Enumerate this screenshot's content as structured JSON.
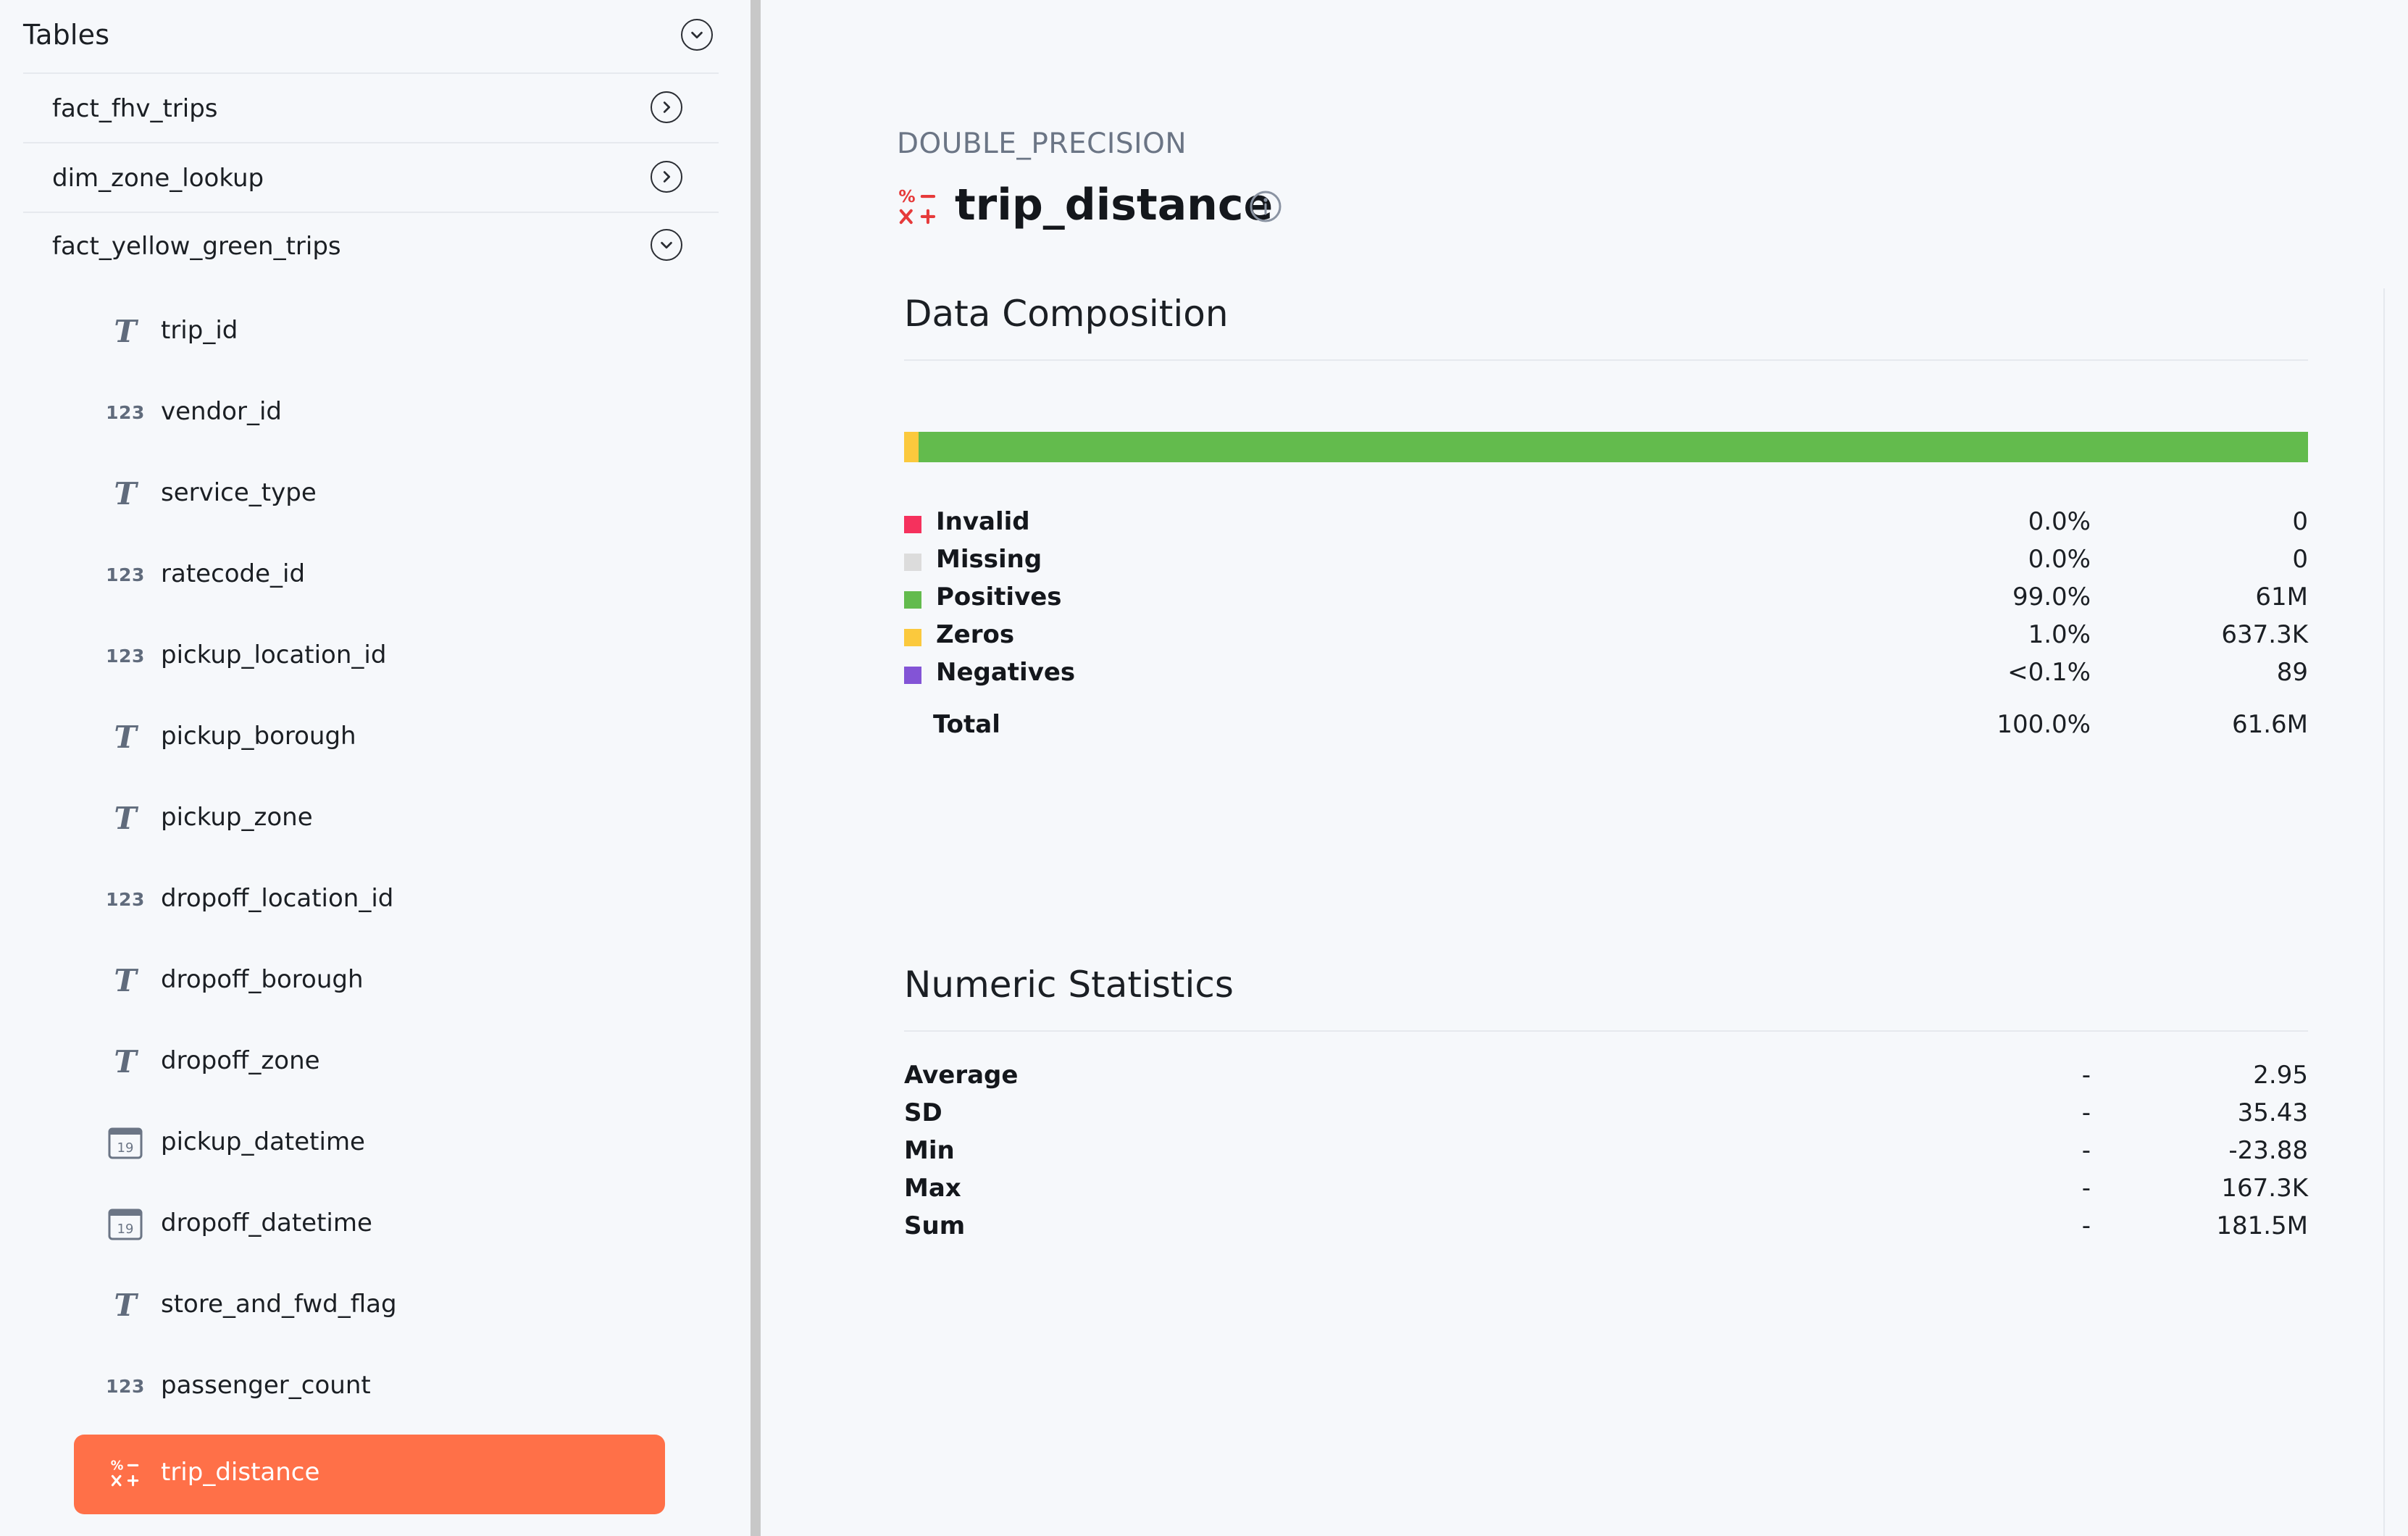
{
  "sidebar": {
    "title": "Tables",
    "tables": [
      {
        "name": "fact_fhv_trips",
        "expanded": false
      },
      {
        "name": "dim_zone_lookup",
        "expanded": false
      },
      {
        "name": "fact_yellow_green_trips",
        "expanded": true
      }
    ],
    "columns": [
      {
        "name": "trip_id",
        "type_icon": "text-type-icon",
        "glyph": "T"
      },
      {
        "name": "vendor_id",
        "type_icon": "integer-type-icon",
        "glyph": "123"
      },
      {
        "name": "service_type",
        "type_icon": "text-type-icon",
        "glyph": "T"
      },
      {
        "name": "ratecode_id",
        "type_icon": "integer-type-icon",
        "glyph": "123"
      },
      {
        "name": "pickup_location_id",
        "type_icon": "integer-type-icon",
        "glyph": "123"
      },
      {
        "name": "pickup_borough",
        "type_icon": "text-type-icon",
        "glyph": "T"
      },
      {
        "name": "pickup_zone",
        "type_icon": "text-type-icon",
        "glyph": "T"
      },
      {
        "name": "dropoff_location_id",
        "type_icon": "integer-type-icon",
        "glyph": "123"
      },
      {
        "name": "dropoff_borough",
        "type_icon": "text-type-icon",
        "glyph": "T"
      },
      {
        "name": "dropoff_zone",
        "type_icon": "text-type-icon",
        "glyph": "T"
      },
      {
        "name": "pickup_datetime",
        "type_icon": "calendar-type-icon",
        "glyph": "19"
      },
      {
        "name": "dropoff_datetime",
        "type_icon": "calendar-type-icon",
        "glyph": "19"
      },
      {
        "name": "store_and_fwd_flag",
        "type_icon": "text-type-icon",
        "glyph": "T"
      },
      {
        "name": "passenger_count",
        "type_icon": "integer-type-icon",
        "glyph": "123"
      },
      {
        "name": "trip_distance",
        "type_icon": "numeric-type-icon",
        "glyph": "",
        "active": true
      }
    ]
  },
  "column": {
    "data_type": "DOUBLE_PRECISION",
    "name": "trip_distance"
  },
  "composition": {
    "title": "Data Composition",
    "bar": [
      {
        "key": "invalid",
        "fraction": 0.0,
        "color": "#f5315d"
      },
      {
        "key": "missing",
        "fraction": 0.0,
        "color": "#dcdcdc"
      },
      {
        "key": "zeros",
        "fraction": 0.0103,
        "color": "#fbc93d"
      },
      {
        "key": "positives",
        "fraction": 0.9897,
        "color": "#63bb4d"
      },
      {
        "key": "negatives",
        "fraction": 0.0,
        "color": "#8354d6"
      }
    ],
    "rows": [
      {
        "name": "Invalid",
        "pct": "0.0%",
        "count": "0",
        "color": "#f5315d"
      },
      {
        "name": "Missing",
        "pct": "0.0%",
        "count": "0",
        "color": "#dcdcdc"
      },
      {
        "name": "Positives",
        "pct": "99.0%",
        "count": "61M",
        "color": "#63bb4d"
      },
      {
        "name": "Zeros",
        "pct": "1.0%",
        "count": "637.3K",
        "color": "#fbc93d"
      },
      {
        "name": "Negatives",
        "pct": "<0.1%",
        "count": "89",
        "color": "#8354d6"
      }
    ],
    "total": {
      "name": "Total",
      "pct": "100.0%",
      "count": "61.6M"
    }
  },
  "numeric": {
    "title": "Numeric Statistics",
    "rows": [
      {
        "name": "Average",
        "pct": "-",
        "value": "2.95"
      },
      {
        "name": "SD",
        "pct": "-",
        "value": "35.43"
      },
      {
        "name": "Min",
        "pct": "-",
        "value": "-23.88"
      },
      {
        "name": "Max",
        "pct": "-",
        "value": "167.3K"
      },
      {
        "name": "Sum",
        "pct": "-",
        "value": "181.5M"
      }
    ]
  },
  "colors": {
    "accent": "#ff7048",
    "background": "#f6f8fb",
    "numeric_icon": "#e63a3a"
  }
}
